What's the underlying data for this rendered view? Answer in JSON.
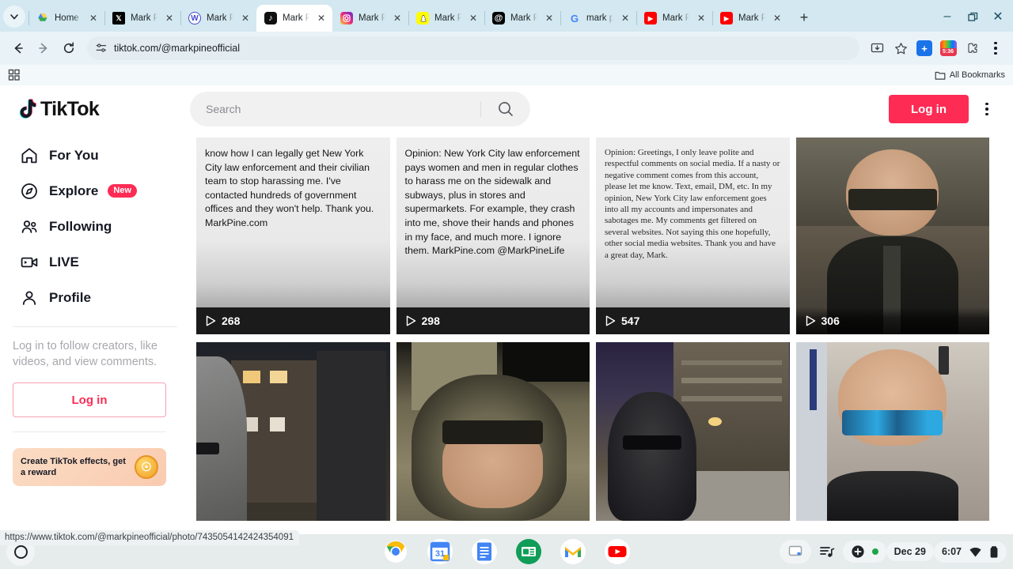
{
  "browser": {
    "tabs": [
      {
        "title": "Home -",
        "icon": "google-drive-icon",
        "active": false
      },
      {
        "title": "Mark Pi",
        "icon": "x-twitter-icon",
        "active": false
      },
      {
        "title": "Mark Pi",
        "icon": "wordpress-icon",
        "active": false
      },
      {
        "title": "Mark Pi",
        "icon": "tiktok-icon",
        "active": true
      },
      {
        "title": "Mark Pi",
        "icon": "instagram-icon",
        "active": false
      },
      {
        "title": "Mark Pi",
        "icon": "snapchat-icon",
        "active": false
      },
      {
        "title": "Mark Pi",
        "icon": "threads-icon",
        "active": false
      },
      {
        "title": "mark pi",
        "icon": "google-icon",
        "active": false
      },
      {
        "title": "Mark Pi",
        "icon": "youtube-icon",
        "active": false
      },
      {
        "title": "Mark Pi",
        "icon": "youtube-icon",
        "active": false
      }
    ],
    "new_tab_label": "+",
    "window_controls": {
      "minimize": "–",
      "maximize": "❐",
      "close": "✕"
    },
    "toolbar": {
      "back": "←",
      "forward": "→",
      "reload": "↻",
      "url": "tiktok.com/@markpineofficial",
      "extension_badge_label": "+",
      "extension_timer_label": "5:36"
    },
    "bookmarks": {
      "all_bookmarks_label": "All Bookmarks"
    },
    "status_link": "https://www.tiktok.com/@markpineofficial/photo/7435054142424354091"
  },
  "tiktok": {
    "logo_text": "TikTok",
    "search": {
      "placeholder": "Search",
      "value": ""
    },
    "login_button": "Log in",
    "sidebar": {
      "items": [
        {
          "label": "For You",
          "icon": "home-icon",
          "badge": ""
        },
        {
          "label": "Explore",
          "icon": "compass-icon",
          "badge": "New"
        },
        {
          "label": "Following",
          "icon": "people-icon",
          "badge": ""
        },
        {
          "label": "LIVE",
          "icon": "live-video-icon",
          "badge": ""
        },
        {
          "label": "Profile",
          "icon": "person-icon",
          "badge": ""
        }
      ],
      "login_prompt": "Log in to follow creators, like videos, and view comments.",
      "login_button": "Log in",
      "promo": {
        "text": "Create TikTok effects, get a reward",
        "coin_icon": "coin-icon"
      }
    },
    "videos": [
      {
        "kind": "text",
        "style": "sans",
        "text": "know how I can legally get New York City law enforcement and their civilian team to stop harassing me. I've contacted hundreds of government offices and they won't help. Thank you. MarkPine.com",
        "views": "268"
      },
      {
        "kind": "text",
        "style": "sans",
        "text": "Opinion: New York City law enforcement pays women and men in regular clothes to harass me on the sidewalk and subways, plus in stores and supermarkets. For example, they crash into me, shove their hands and phones in my face, and much more. I ignore them. MarkPine.com @MarkPineLife",
        "views": "298"
      },
      {
        "kind": "text",
        "style": "serif",
        "text": "Opinion: Greetings, I only leave polite and respectful comments on social media. If a nasty or negative comment comes from this account, please let me know. Text, email, DM, etc. In my opinion, New York City law enforcement goes into all my accounts and impersonates and sabotages me. My comments get filtered on several websites. Not saying this one hopefully, other social media websites. Thank you and have a great day, Mark.",
        "views": "547"
      },
      {
        "kind": "photo",
        "scene": "man-with-sunglasses-black-jacket-daytime-street",
        "text": "",
        "views": "306"
      },
      {
        "kind": "photo",
        "scene": "night-street-buildings-man-in-hat-lower-left",
        "text": "",
        "views": ""
      },
      {
        "kind": "photo",
        "scene": "man-in-hooded-parka-sunglasses-closeup-night",
        "text": "",
        "views": ""
      },
      {
        "kind": "photo",
        "scene": "man-in-hood-sunglasses-city-street-night",
        "text": "",
        "views": ""
      },
      {
        "kind": "photo",
        "scene": "man-with-blue-mirrored-sunglasses-indoors",
        "text": "",
        "views": ""
      }
    ]
  },
  "shelf": {
    "launcher_icon": "launcher-circle-icon",
    "apps": [
      {
        "name": "chrome-icon",
        "running": true
      },
      {
        "name": "google-calendar-icon",
        "running": false
      },
      {
        "name": "google-docs-icon",
        "running": false
      },
      {
        "name": "google-classroom-icon",
        "running": false
      },
      {
        "name": "gmail-icon",
        "running": false
      },
      {
        "name": "youtube-icon",
        "running": false
      }
    ],
    "tray": {
      "cast_icon": "screen-cast-icon",
      "media_icon": "media-playlist-icon",
      "dnd_icon": "plus-circle-icon",
      "date": "Dec 29",
      "time": "6:07",
      "wifi_icon": "wifi-icon",
      "battery_icon": "battery-icon"
    }
  },
  "colors": {
    "tiktok_red": "#fe2c55",
    "chrome_tabstrip": "#d3e8f0",
    "shelf": "#e6ebec"
  }
}
